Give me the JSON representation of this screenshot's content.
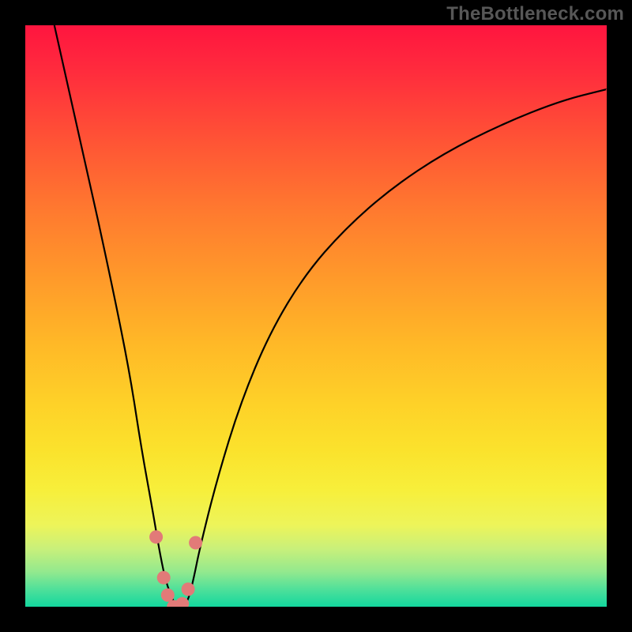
{
  "watermark": "TheBottleneck.com",
  "chart_data": {
    "type": "line",
    "title": "",
    "xlabel": "",
    "ylabel": "",
    "xlim": [
      0,
      100
    ],
    "ylim": [
      0,
      100
    ],
    "grid": false,
    "legend": false,
    "background_gradient": {
      "top": "#ff153f",
      "middle": "#fed128",
      "bottom": "#13d79e"
    },
    "series": [
      {
        "name": "bottleneck-curve",
        "color": "#000000",
        "x": [
          5,
          10,
          15,
          18,
          20,
          22,
          23,
          24,
          25,
          26,
          27,
          28,
          29,
          30,
          33,
          37,
          42,
          48,
          55,
          63,
          72,
          82,
          92,
          100
        ],
        "values": [
          100,
          78,
          55,
          40,
          27,
          16,
          10,
          5,
          2,
          0,
          0,
          1,
          5,
          10,
          22,
          35,
          47,
          57,
          65,
          72,
          78,
          83,
          87,
          89
        ]
      }
    ],
    "markers": [
      {
        "x": 22.5,
        "y": 12,
        "color": "#e27a78"
      },
      {
        "x": 23.8,
        "y": 5,
        "color": "#e27a78"
      },
      {
        "x": 24.5,
        "y": 2,
        "color": "#e27a78"
      },
      {
        "x": 25.5,
        "y": 0,
        "color": "#e27a78"
      },
      {
        "x": 27.0,
        "y": 0.5,
        "color": "#e27a78"
      },
      {
        "x": 28.0,
        "y": 3,
        "color": "#e27a78"
      },
      {
        "x": 29.3,
        "y": 11,
        "color": "#e27a78"
      }
    ]
  }
}
